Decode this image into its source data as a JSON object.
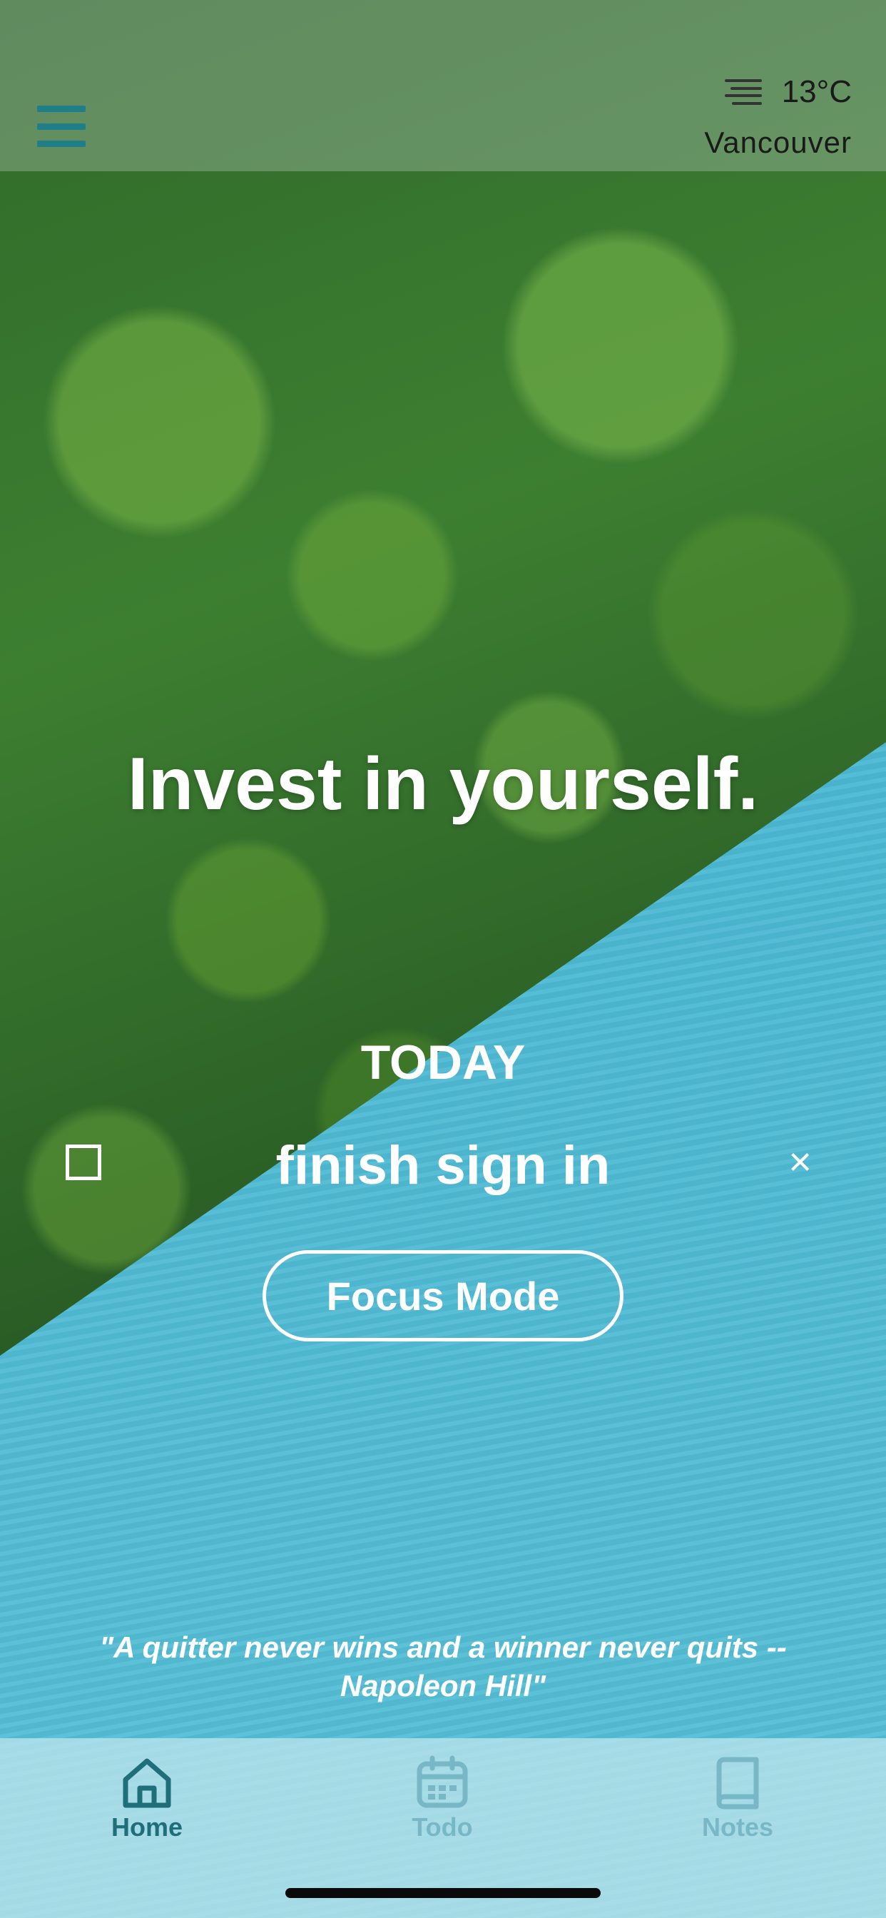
{
  "weather": {
    "temperature": "13°C",
    "city": "Vancouver",
    "icon": "fog-icon"
  },
  "main": {
    "mantra": "Invest in yourself.",
    "today_label": "TODAY",
    "task": {
      "text": "finish sign in",
      "delete_label": "×"
    },
    "focus_button": "Focus Mode",
    "quote": "\"A quitter never wins and a winner never quits -- Napoleon Hill\""
  },
  "tabs": [
    {
      "label": "Home",
      "icon": "home-icon",
      "active": true
    },
    {
      "label": "Todo",
      "icon": "calendar-icon",
      "active": false
    },
    {
      "label": "Notes",
      "icon": "book-icon",
      "active": false
    }
  ],
  "colors": {
    "accent": "#1f6f7a",
    "inactive_tab": "#78b8c6"
  }
}
